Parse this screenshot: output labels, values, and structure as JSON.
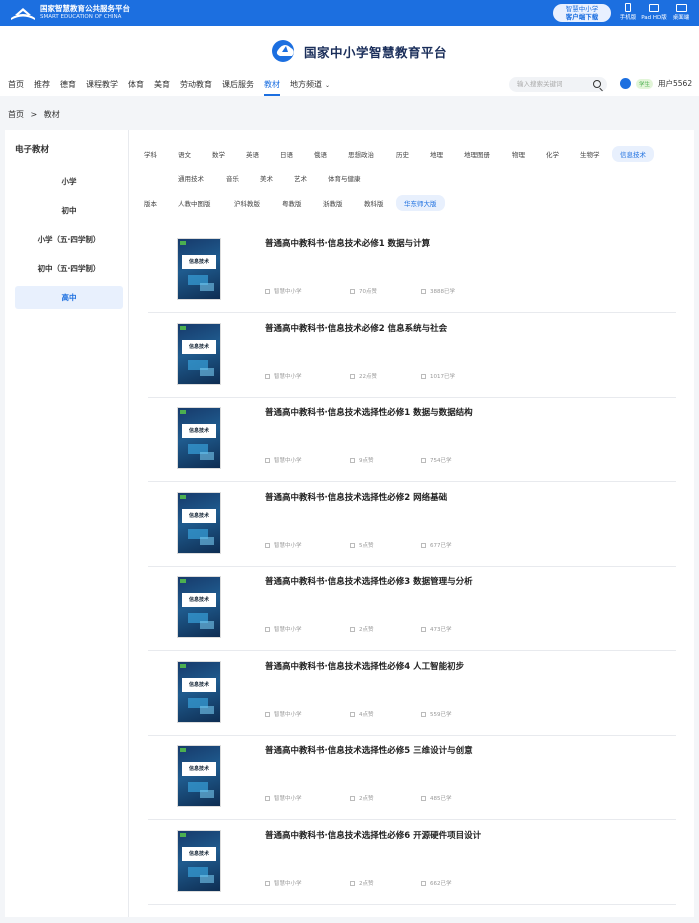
{
  "topbar": {
    "brand_cn": "国家智慧教育公共服务平台",
    "brand_en": "SMART EDUCATION OF CHINA",
    "download_line1": "智慧中小学",
    "download_line2": "客户端下载",
    "devices": [
      "手机版",
      "Pad HD版",
      "桌面端"
    ]
  },
  "header": {
    "title": "国家中小学智慧教育平台",
    "nav": [
      "首页",
      "推荐",
      "德育",
      "课程教学",
      "体育",
      "美育",
      "劳动教育",
      "课后服务",
      "教材",
      "地方频道"
    ],
    "nav_active": "教材",
    "search_placeholder": "输入搜索关键词",
    "user_badge": "学生",
    "user_name": "用户5562"
  },
  "breadcrumb": {
    "home": "首页",
    "sep": ">",
    "current": "教材"
  },
  "sidebar": {
    "title": "电子教材",
    "items": [
      "小学",
      "初中",
      "小学（五·四学制）",
      "初中（五·四学制）",
      "高中"
    ],
    "selected": "高中"
  },
  "filters": {
    "subjects_row1": [
      "学科",
      "语文",
      "数学",
      "英语",
      "日语",
      "俄语",
      "思想政治",
      "历史",
      "地理",
      "地理图册",
      "物理",
      "化学",
      "生物学",
      "信息技术"
    ],
    "subjects_row2": [
      "通用技术",
      "音乐",
      "美术",
      "艺术",
      "体育与健康"
    ],
    "selected_subject": "信息技术",
    "editions": [
      "版本",
      "人教中图版",
      "沪科教版",
      "粤教版",
      "浙教版",
      "教科版",
      "华东师大版"
    ],
    "selected_edition": "华东师大版"
  },
  "books": [
    {
      "title": "普通高中教科书·信息技术必修1 数据与计算",
      "source": "智慧中小学",
      "likes": "70点赞",
      "learners": "3888已学"
    },
    {
      "title": "普通高中教科书·信息技术必修2 信息系统与社会",
      "source": "智慧中小学",
      "likes": "22点赞",
      "learners": "1017已学"
    },
    {
      "title": "普通高中教科书·信息技术选择性必修1 数据与数据结构",
      "source": "智慧中小学",
      "likes": "9点赞",
      "learners": "754已学"
    },
    {
      "title": "普通高中教科书·信息技术选择性必修2 网络基础",
      "source": "智慧中小学",
      "likes": "5点赞",
      "learners": "677已学"
    },
    {
      "title": "普通高中教科书·信息技术选择性必修3 数据管理与分析",
      "source": "智慧中小学",
      "likes": "2点赞",
      "learners": "473已学"
    },
    {
      "title": "普通高中教科书·信息技术选择性必修4 人工智能初步",
      "source": "智慧中小学",
      "likes": "4点赞",
      "learners": "559已学"
    },
    {
      "title": "普通高中教科书·信息技术选择性必修5 三维设计与创意",
      "source": "智慧中小学",
      "likes": "2点赞",
      "learners": "485已学"
    },
    {
      "title": "普通高中教科书·信息技术选择性必修6 开源硬件项目设计",
      "source": "智慧中小学",
      "likes": "2点赞",
      "learners": "662已学"
    }
  ],
  "cover_text": "信息技术",
  "colors": {
    "accent": "#1c6fe0",
    "topbar": "#1c6fe0"
  }
}
